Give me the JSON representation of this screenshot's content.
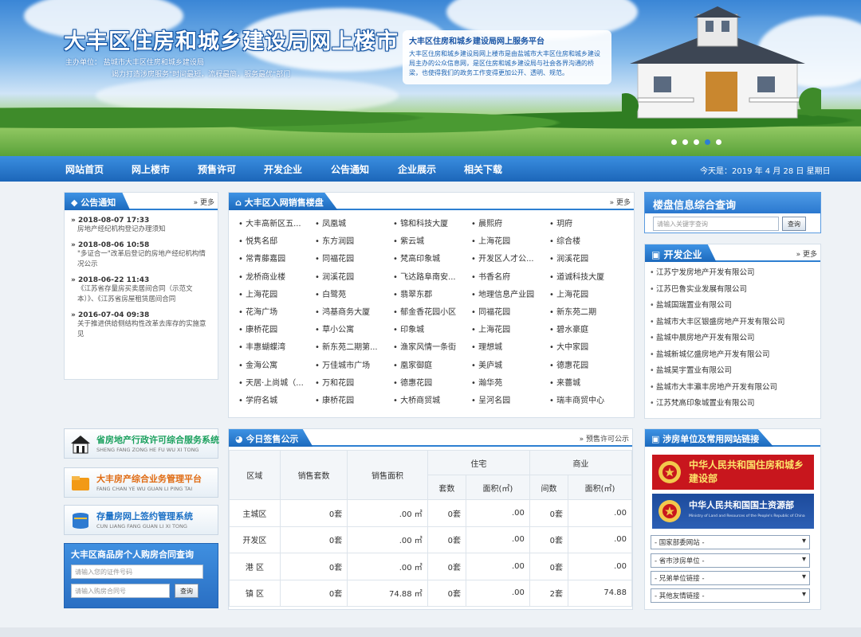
{
  "header": {
    "site_title": "大丰区住房和城乡建设局网上楼市",
    "host": "主办单位：  盐城市大丰区住房和城乡建设局",
    "slogan": "竭力打造涉房服务\"时间最短，流程最简，服务最优\"部门",
    "intro_title": "大丰区住房和城乡建设局网上服务平台",
    "intro_text": "大丰区住房和城乡建设局网上楼市是由盐城市大丰区住房和城乡建设局主办的公众信息网，是区住房和城乡建设局与社会各界沟通的桥梁，也使得我们的政务工作变得更加公开、透明、规范。",
    "carousel_dots": 5,
    "carousel_active": 3
  },
  "nav": {
    "items": [
      "网站首页",
      "网上楼市",
      "预售许可",
      "开发企业",
      "公告通知",
      "企业展示",
      "相关下载"
    ],
    "date": "今天是：2019 年 4 月 28 日  星期日"
  },
  "notices": {
    "title": "公告通知",
    "more": "更多",
    "items": [
      {
        "date": "2018-08-07 17:33",
        "text": "房地产经纪机构登记办理须知"
      },
      {
        "date": "2018-08-06 10:58",
        "text": "\"多证合一\"改革后登记的房地产经纪机构情况公示"
      },
      {
        "date": "2018-06-22 11:43",
        "text": "《江苏省存量房买卖居间合同（示范文本）》、《江苏省房屋租赁居间合同"
      },
      {
        "date": "2016-07-04 09:38",
        "text": "关于推进供给侧结构性改革去库存的实施意见"
      }
    ]
  },
  "listings": {
    "title": "大丰区入网销售楼盘",
    "more": "更多",
    "rows": [
      [
        "大丰高新区五...",
        "凤凰城",
        "锦和科技大厦",
        "晨熙府",
        "玥府"
      ],
      [
        "悦隽名邸",
        "东方润园",
        "紫云城",
        "上海花园",
        "综合楼"
      ],
      [
        "常青藤嘉园",
        "同福花园",
        "梵高印象城",
        "开发区人才公...",
        "润溪花园"
      ],
      [
        "龙桥商业楼",
        "润溪花园",
        "飞达路阜南安...",
        "书香名府",
        "道诚科技大厦"
      ],
      [
        "上海花园",
        "白鹭苑",
        "翡翠东郡",
        "地理信息产业园",
        "上海花园"
      ],
      [
        "花海广场",
        "鸿基商务大厦",
        "郁金香花园小区",
        "同福花园",
        "新东苑二期"
      ],
      [
        "康桥花园",
        "草小公寓",
        "印象城",
        "上海花园",
        "碧水豪庭"
      ],
      [
        "丰惠蝴蝶湾",
        "新东苑二期第...",
        "渔家风情一条街",
        "理想城",
        "大中家园"
      ],
      [
        "金海公寓",
        "万佳城市广场",
        "凰家御庭",
        "美庐城",
        "德惠花园"
      ],
      [
        "天居·上尚城（...",
        "万和花园",
        "德惠花园",
        "瀚华苑",
        "来薔城"
      ],
      [
        "学府名城",
        "康桥花园",
        "大桥商贸城",
        "呈河名园",
        "瑞丰商贸中心"
      ]
    ]
  },
  "search": {
    "title": "楼盘信息综合查询",
    "placeholder": "请输入关键字查询",
    "button": "查询"
  },
  "developers": {
    "title": "开发企业",
    "more": "更多",
    "items": [
      "江苏宁发房地产开发有限公司",
      "江苏巴鲁实业发展有限公司",
      "盐城国瑞置业有限公司",
      "盐城市大丰区银盛房地产开发有限公司",
      "盐城中晨房地产开发有限公司",
      "盐城新城亿盛房地产开发有限公司",
      "盐城昊宇置业有限公司",
      "盐城市大丰瀛丰房地产开发有限公司",
      "江苏梵高印象城置业有限公司"
    ]
  },
  "services": [
    {
      "title": "省房地产行政许可综合服务系统",
      "pinyin": "SHENG FANG ZONG HE FU WU XI TONG",
      "icon": "building-icon"
    },
    {
      "title": "大丰房产综合业务管理平台",
      "pinyin": "FANG CHAN YE WU GUAN LI PING TAI",
      "icon": "folder-icon"
    },
    {
      "title": "存量房网上签约管理系统",
      "pinyin": "CUN LIANG FANG GUAN LI XI TONG",
      "icon": "database-icon"
    }
  ],
  "contract_query": {
    "title": "大丰区商品房个人购房合同查询",
    "id_placeholder": "请输入您的证件号码",
    "contract_placeholder": "请输入购房合同号",
    "button": "查询"
  },
  "sales": {
    "title": "今日签售公示",
    "presale_link": "预售许可公示",
    "headers": {
      "region": "区域",
      "units": "销售套数",
      "area": "销售面积",
      "residential": "住宅",
      "commercial": "商业",
      "sets": "套数",
      "area_sqm": "面积(㎡)",
      "rooms": "间数"
    },
    "rows": [
      {
        "region": "主城区",
        "units": "0套",
        "area": ".00 ㎡",
        "res_sets": "0套",
        "res_area": ".00",
        "com_rooms": "0套",
        "com_area": ".00"
      },
      {
        "region": "开发区",
        "units": "0套",
        "area": ".00 ㎡",
        "res_sets": "0套",
        "res_area": ".00",
        "com_rooms": "0套",
        "com_area": ".00"
      },
      {
        "region": "港  区",
        "units": "0套",
        "area": ".00 ㎡",
        "res_sets": "0套",
        "res_area": ".00",
        "com_rooms": "0套",
        "com_area": ".00"
      },
      {
        "region": "镇  区",
        "units": "0套",
        "area": "74.88 ㎡",
        "res_sets": "0套",
        "res_area": ".00",
        "com_rooms": "2套",
        "com_area": "74.88"
      }
    ]
  },
  "links": {
    "title": "涉房单位及常用网站链接",
    "banner1": "中华人民共和国住房和城乡建设部",
    "banner2": "中华人民共和国国土资源部",
    "banner2_sub": "Ministry of Land and Resources of the People's Republic of China",
    "selects": [
      "- 国家部委网站 -",
      "- 省市涉房单位 -",
      "- 兄弟单位链接 -",
      "- 其他友情链接 -"
    ]
  }
}
